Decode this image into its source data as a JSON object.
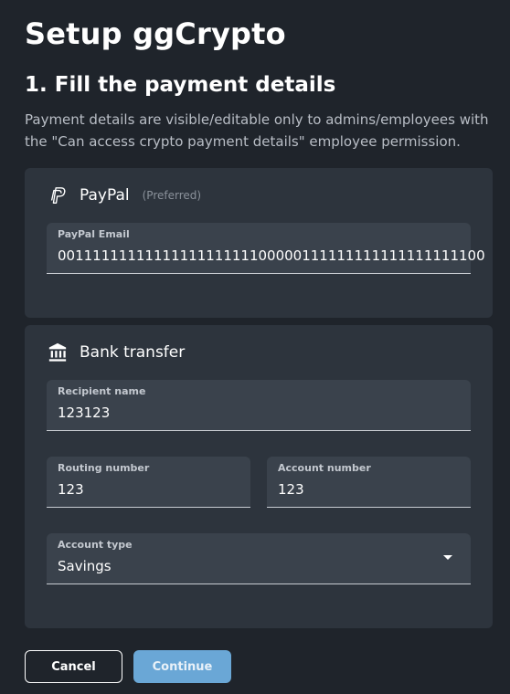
{
  "page": {
    "title": "Setup ggCrypto",
    "step_title": "1. Fill the payment details",
    "description": "Payment details are visible/editable only to admins/employees with the \"Can access crypto payment details\" employee permission."
  },
  "paypal": {
    "icon": "paypal-icon",
    "name": "PayPal",
    "tag": "(Preferred)",
    "email_label": "PayPal Email",
    "email_value": "0011111111111111111111100000111111111111111111100"
  },
  "bank": {
    "icon": "bank-icon",
    "name": "Bank transfer",
    "recipient_label": "Recipient name",
    "recipient_value": "123123",
    "routing_label": "Routing number",
    "routing_value": "123",
    "account_label": "Account number",
    "account_value": "123",
    "account_type_label": "Account type",
    "account_type_value": "Savings"
  },
  "buttons": {
    "cancel": "Cancel",
    "continue": "Continue"
  },
  "colors": {
    "background": "#1f242b",
    "card": "#2d343d",
    "field": "#3a424c",
    "accent": "#6aa7d6"
  }
}
